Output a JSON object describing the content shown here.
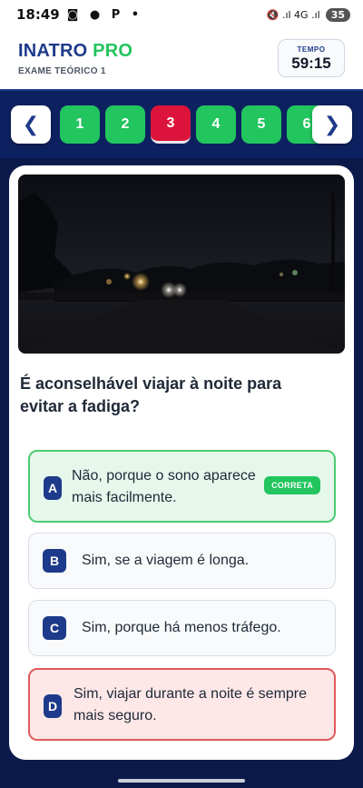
{
  "status_bar": {
    "time": "18:49",
    "left_icons": "◙ ● P •",
    "right_icons": "🔇 .ıl 4G .ıl",
    "battery": "35"
  },
  "header": {
    "brand_main": "INATRO",
    "brand_accent": "PRO",
    "subtitle": "EXAME TEÓRICO 1",
    "timer_label": "TEMPO",
    "timer_value": "59:15"
  },
  "nav": {
    "prev_label": "❮",
    "next_label": "❯",
    "questions": [
      "1",
      "2",
      "3",
      "4",
      "5",
      "6"
    ],
    "current": "3"
  },
  "question": {
    "text": "É aconselhável viajar à noite para evitar a fadiga?"
  },
  "options": [
    {
      "letter": "A",
      "text": "Não, porque o sono aparece mais facilmente.",
      "badge": "CORRETA",
      "state": "correct"
    },
    {
      "letter": "B",
      "text": "Sim, se a viagem é longa.",
      "state": "neutral"
    },
    {
      "letter": "C",
      "text": "Sim, porque há menos tráfego.",
      "state": "neutral"
    },
    {
      "letter": "D",
      "text": "Sim, viajar durante a noite é sempre mais seguro.",
      "state": "wrong"
    }
  ],
  "colors": {
    "brand_blue": "#1e3a8a",
    "brand_green": "#22c55e",
    "current_red": "#dc143c",
    "correct_bg": "#e6f7ec",
    "wrong_bg": "#fde7e7"
  }
}
